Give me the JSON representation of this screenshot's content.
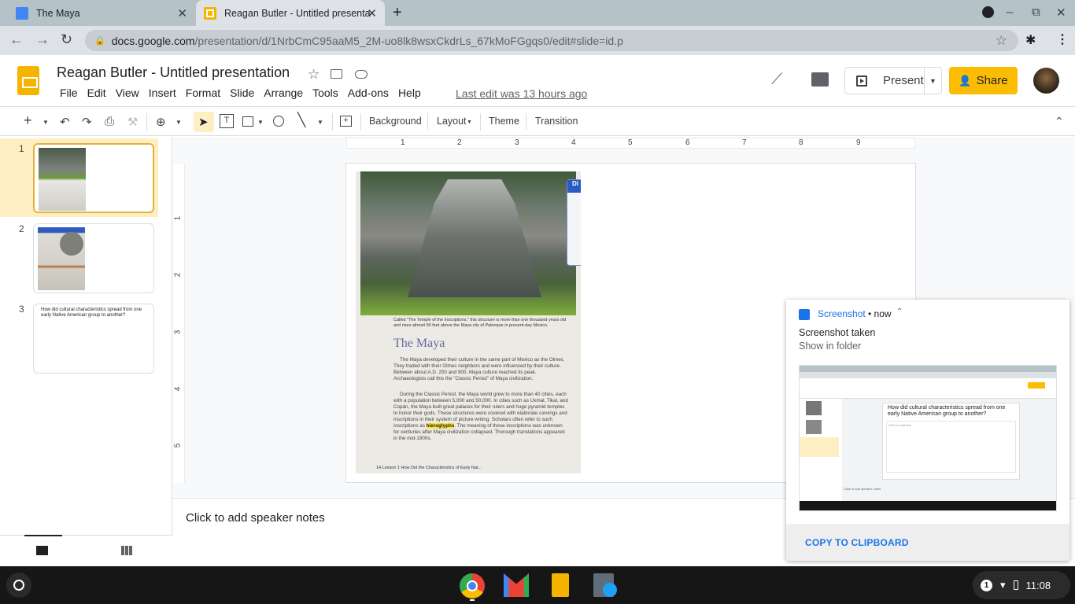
{
  "browser": {
    "tabs": [
      {
        "title": "The Maya",
        "icon": "classroom-icon",
        "active": false
      },
      {
        "title": "Reagan Butler - Untitled presenta",
        "icon": "slides-icon",
        "active": true
      }
    ],
    "url_host": "docs.google.com",
    "url_path": "/presentation/d/1NrbCmC95aaM5_2M-uo8lk8wsxCkdrLs_67kMoFGgqs0/edit#slide=id.p"
  },
  "doc": {
    "title": "Reagan Butler - Untitled presentation",
    "menu": [
      "File",
      "Edit",
      "View",
      "Insert",
      "Format",
      "Slide",
      "Arrange",
      "Tools",
      "Add-ons",
      "Help"
    ],
    "last_edit": "Last edit was 13 hours ago",
    "present_label": "Present",
    "share_label": "Share"
  },
  "toolbar": {
    "background_label": "Background",
    "layout_label": "Layout",
    "theme_label": "Theme",
    "transition_label": "Transition"
  },
  "ruler": {
    "h_ticks": [
      "1",
      "2",
      "3",
      "4",
      "5",
      "6",
      "7",
      "8",
      "9"
    ],
    "v_ticks": [
      "1",
      "2",
      "3",
      "4",
      "5"
    ]
  },
  "filmstrip": {
    "slides": [
      {
        "number": "1",
        "selected": true,
        "kind": "image"
      },
      {
        "number": "2",
        "selected": false,
        "kind": "image"
      },
      {
        "number": "3",
        "selected": false,
        "kind": "text",
        "text": "How did cultural characteristics spread from one early Native American group to another?"
      }
    ]
  },
  "slide": {
    "caption": "Called \"The Temple of the Inscriptions,\" this structure is more than one thousand years old and rises almost 90 feet above the Maya city of Palenque in present-day Mexico.",
    "heading": "The Maya",
    "paragraph1": "The Maya developed their culture in the same part of Mexico as the Olmec. They traded with their Olmec neighbors and were influenced by their culture. Between about A.D. 250 and 900, Maya culture reached its peak. Archaeologists call this the \"Classic Period\" of Maya civilization.",
    "paragraph2_before": "During the Classic Period, the Maya world grew to more than 40 cities, each with a population between 5,000 and 50,000. In cities such as Uxmal, Tikal, and Copán, the Maya built great palaces for their rulers and huge pyramid temples to honor their gods. These structures were covered with elaborate carvings and inscriptions in their system of picture writing. Scholars often refer to such inscriptions as ",
    "paragraph2_highlight": "hieroglyphs",
    "paragraph2_after": ". The meaning of these inscriptions was unknown for centuries after Maya civilization collapsed. Thorough translations appeared in the mid-1900s.",
    "footer": "14  Lesson 1  How Did the Characteristics of Early Nat...",
    "sidebox_header": "Di"
  },
  "notes": {
    "placeholder": "Click to add speaker notes"
  },
  "notification": {
    "app": "Screenshot",
    "time": "• now",
    "title": "Screenshot taken",
    "subtitle": "Show in folder",
    "action": "COPY TO CLIPBOARD",
    "preview": {
      "slide_title": "How did cultural characteristics spread from one early Native American group to another?",
      "body_placeholder": "Click to add text",
      "notes_placeholder": "Click to add speaker notes"
    }
  },
  "shelf": {
    "apps": [
      "Chrome",
      "Gmail",
      "Slides",
      "Calculator"
    ],
    "notification_count": "1",
    "time": "11:08"
  }
}
